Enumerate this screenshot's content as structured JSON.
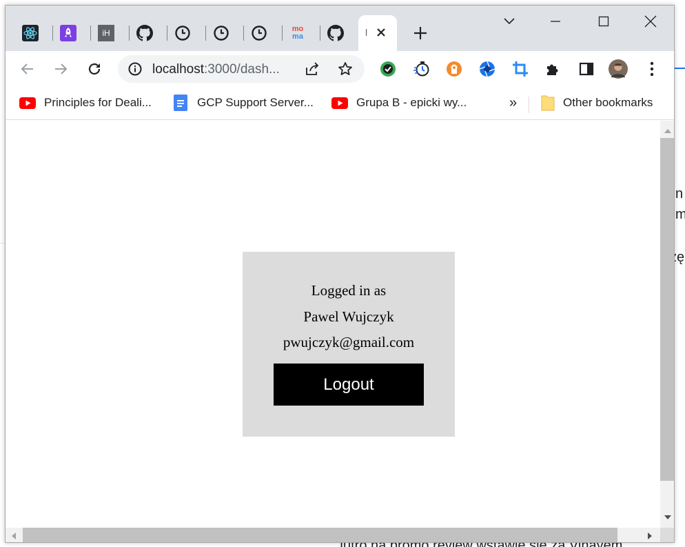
{
  "background_page": {
    "fragments": [
      "n",
      "m",
      "zę",
      "Jutro na promo review wstawię się za Vinayem"
    ]
  },
  "browser": {
    "tabs": [
      {
        "icon": "react-icon"
      },
      {
        "icon": "rocket-icon"
      },
      {
        "icon": "ih-icon",
        "text": "iH"
      },
      {
        "icon": "github-icon"
      },
      {
        "icon": "clock-icon"
      },
      {
        "icon": "clock-icon"
      },
      {
        "icon": "clock-icon"
      },
      {
        "icon": "moma-icon",
        "text_top": "mo",
        "text_bottom": "ma"
      },
      {
        "icon": "github-icon"
      }
    ],
    "active_tab": {
      "title_fragment": "l"
    },
    "address_bar": {
      "host": "localhost",
      "path": ":3000/dash..."
    },
    "extensions": [
      "check-extension-icon",
      "stopwatch-extension-icon",
      "vpn-extension-icon",
      "aperture-extension-icon",
      "crop-extension-icon",
      "puzzle-icon",
      "side-panel-icon",
      "profile-avatar"
    ],
    "bookmarks": [
      {
        "label": "Principles for Deali...",
        "icon": "youtube-icon"
      },
      {
        "label": "GCP Support Server...",
        "icon": "docs-icon"
      },
      {
        "label": "Grupa B - epicki wy...",
        "icon": "youtube-icon"
      }
    ],
    "bookmarks_overflow": "»",
    "other_bookmarks": "Other bookmarks"
  },
  "page": {
    "logged_in_label": "Logged in as",
    "user_name": "Pawel Wujczyk",
    "user_email": "pwujczyk@gmail.com",
    "logout_label": "Logout"
  },
  "colors": {
    "card_bg": "#dcdcdc",
    "button_bg": "#000000",
    "button_text": "#ffffff",
    "tabstrip_bg": "#dee1e6",
    "youtube_red": "#ff0000",
    "docs_blue": "#4285f4"
  }
}
